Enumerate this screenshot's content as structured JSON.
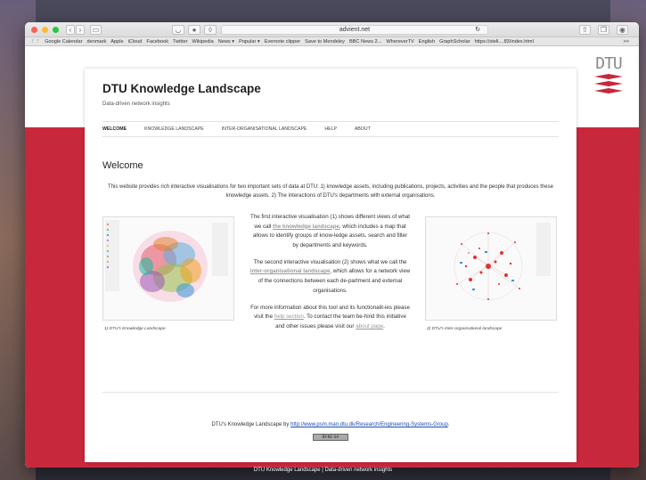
{
  "browser": {
    "url": "advient.net",
    "bookmarks": [
      "Google Calendar",
      "denmark",
      "Apple",
      "iCloud",
      "Facebook",
      "Twitter",
      "Wikipedia",
      "News ▾",
      "Popular ▾",
      "Evernote clipper",
      "Save to Mendeley",
      "BBC News 2...",
      "WhereverTV",
      "English",
      "GraphScholar",
      "https://stell....83/index.html"
    ],
    "overflow": ">>"
  },
  "logo": "DTU",
  "site": {
    "title": "DTU Knowledge Landscape",
    "subtitle": "Data-driven network insights"
  },
  "nav": [
    "WELCOME",
    "KNOWLEDGE LANDSCAPE",
    "INTER-ORGANISATIONAL LANDSCAPE",
    "HELP",
    "ABOUT"
  ],
  "main": {
    "heading": "Welcome",
    "intro": "This website provides rich interactive visualisations for two important sets of data at DTU: 1) knowledge assets, including publications, projects, activities and the people that produces these knowledge assets. 2) The interactions of DTU's departments with external organisations.",
    "p1_pre": "The first interactive visualisation (1) shows different views of what we call ",
    "p1_link": "the knowledge landscape",
    "p1_post": ", which includes a map that allows to identify groups of know-ledge assets, search and filter by departments and keywords.",
    "p2_pre": "The second interactive visualisation (2) shows what we call the ",
    "p2_link": "inter-organisational landscape",
    "p2_post": ", which allows for a network view of the connections between each de-partment and external organisations.",
    "p3_pre": "For more information about this tool and its functionalit-ies please visit the ",
    "p3_link": "help section",
    "p3_mid": ". To contact the team be-hind this initiative and other issues please visit our ",
    "p3_link2": "about page",
    "p3_end": ".",
    "caption1": "1) DTU's Knowledge Landscape",
    "caption2": "2) DTU's Inter-organisational landscape"
  },
  "footer": {
    "text": "DTU's Knowledge Landscape by ",
    "link": "http://www.psm.man.dtu.dk/Research/Engineering-Systems-Group",
    "end": ".",
    "license": "BY-NC-SA"
  },
  "window_caption": "DTU Knowledge Landscape | Data-driven network insights",
  "colors": {
    "dtu_red": "#c8283c",
    "link_grey": "#999999",
    "footer_link": "#1a4db0"
  }
}
